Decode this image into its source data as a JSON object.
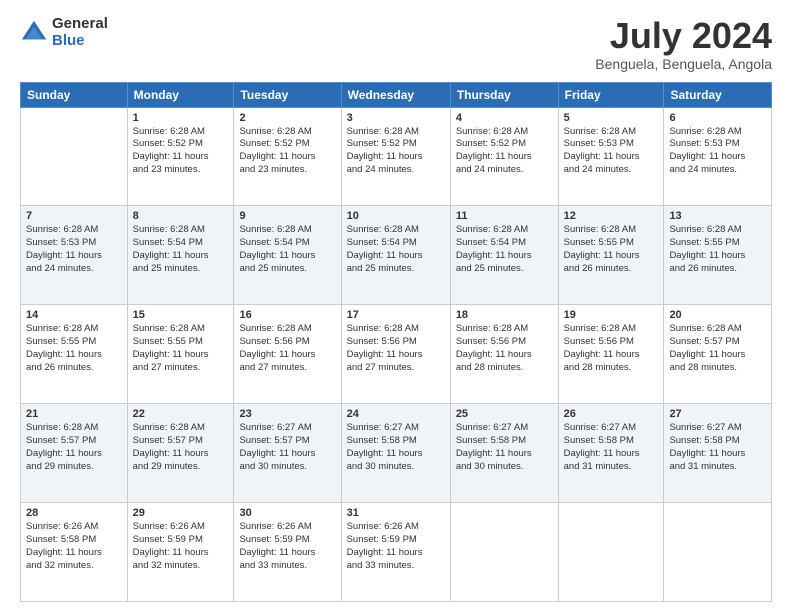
{
  "logo": {
    "general": "General",
    "blue": "Blue"
  },
  "title": "July 2024",
  "location": "Benguela, Benguela, Angola",
  "header_days": [
    "Sunday",
    "Monday",
    "Tuesday",
    "Wednesday",
    "Thursday",
    "Friday",
    "Saturday"
  ],
  "weeks": [
    [
      {
        "day": "",
        "info": ""
      },
      {
        "day": "1",
        "info": "Sunrise: 6:28 AM\nSunset: 5:52 PM\nDaylight: 11 hours\nand 23 minutes."
      },
      {
        "day": "2",
        "info": "Sunrise: 6:28 AM\nSunset: 5:52 PM\nDaylight: 11 hours\nand 23 minutes."
      },
      {
        "day": "3",
        "info": "Sunrise: 6:28 AM\nSunset: 5:52 PM\nDaylight: 11 hours\nand 24 minutes."
      },
      {
        "day": "4",
        "info": "Sunrise: 6:28 AM\nSunset: 5:52 PM\nDaylight: 11 hours\nand 24 minutes."
      },
      {
        "day": "5",
        "info": "Sunrise: 6:28 AM\nSunset: 5:53 PM\nDaylight: 11 hours\nand 24 minutes."
      },
      {
        "day": "6",
        "info": "Sunrise: 6:28 AM\nSunset: 5:53 PM\nDaylight: 11 hours\nand 24 minutes."
      }
    ],
    [
      {
        "day": "7",
        "info": "Sunrise: 6:28 AM\nSunset: 5:53 PM\nDaylight: 11 hours\nand 24 minutes."
      },
      {
        "day": "8",
        "info": "Sunrise: 6:28 AM\nSunset: 5:54 PM\nDaylight: 11 hours\nand 25 minutes."
      },
      {
        "day": "9",
        "info": "Sunrise: 6:28 AM\nSunset: 5:54 PM\nDaylight: 11 hours\nand 25 minutes."
      },
      {
        "day": "10",
        "info": "Sunrise: 6:28 AM\nSunset: 5:54 PM\nDaylight: 11 hours\nand 25 minutes."
      },
      {
        "day": "11",
        "info": "Sunrise: 6:28 AM\nSunset: 5:54 PM\nDaylight: 11 hours\nand 25 minutes."
      },
      {
        "day": "12",
        "info": "Sunrise: 6:28 AM\nSunset: 5:55 PM\nDaylight: 11 hours\nand 26 minutes."
      },
      {
        "day": "13",
        "info": "Sunrise: 6:28 AM\nSunset: 5:55 PM\nDaylight: 11 hours\nand 26 minutes."
      }
    ],
    [
      {
        "day": "14",
        "info": "Sunrise: 6:28 AM\nSunset: 5:55 PM\nDaylight: 11 hours\nand 26 minutes."
      },
      {
        "day": "15",
        "info": "Sunrise: 6:28 AM\nSunset: 5:55 PM\nDaylight: 11 hours\nand 27 minutes."
      },
      {
        "day": "16",
        "info": "Sunrise: 6:28 AM\nSunset: 5:56 PM\nDaylight: 11 hours\nand 27 minutes."
      },
      {
        "day": "17",
        "info": "Sunrise: 6:28 AM\nSunset: 5:56 PM\nDaylight: 11 hours\nand 27 minutes."
      },
      {
        "day": "18",
        "info": "Sunrise: 6:28 AM\nSunset: 5:56 PM\nDaylight: 11 hours\nand 28 minutes."
      },
      {
        "day": "19",
        "info": "Sunrise: 6:28 AM\nSunset: 5:56 PM\nDaylight: 11 hours\nand 28 minutes."
      },
      {
        "day": "20",
        "info": "Sunrise: 6:28 AM\nSunset: 5:57 PM\nDaylight: 11 hours\nand 28 minutes."
      }
    ],
    [
      {
        "day": "21",
        "info": "Sunrise: 6:28 AM\nSunset: 5:57 PM\nDaylight: 11 hours\nand 29 minutes."
      },
      {
        "day": "22",
        "info": "Sunrise: 6:28 AM\nSunset: 5:57 PM\nDaylight: 11 hours\nand 29 minutes."
      },
      {
        "day": "23",
        "info": "Sunrise: 6:27 AM\nSunset: 5:57 PM\nDaylight: 11 hours\nand 30 minutes."
      },
      {
        "day": "24",
        "info": "Sunrise: 6:27 AM\nSunset: 5:58 PM\nDaylight: 11 hours\nand 30 minutes."
      },
      {
        "day": "25",
        "info": "Sunrise: 6:27 AM\nSunset: 5:58 PM\nDaylight: 11 hours\nand 30 minutes."
      },
      {
        "day": "26",
        "info": "Sunrise: 6:27 AM\nSunset: 5:58 PM\nDaylight: 11 hours\nand 31 minutes."
      },
      {
        "day": "27",
        "info": "Sunrise: 6:27 AM\nSunset: 5:58 PM\nDaylight: 11 hours\nand 31 minutes."
      }
    ],
    [
      {
        "day": "28",
        "info": "Sunrise: 6:26 AM\nSunset: 5:58 PM\nDaylight: 11 hours\nand 32 minutes."
      },
      {
        "day": "29",
        "info": "Sunrise: 6:26 AM\nSunset: 5:59 PM\nDaylight: 11 hours\nand 32 minutes."
      },
      {
        "day": "30",
        "info": "Sunrise: 6:26 AM\nSunset: 5:59 PM\nDaylight: 11 hours\nand 33 minutes."
      },
      {
        "day": "31",
        "info": "Sunrise: 6:26 AM\nSunset: 5:59 PM\nDaylight: 11 hours\nand 33 minutes."
      },
      {
        "day": "",
        "info": ""
      },
      {
        "day": "",
        "info": ""
      },
      {
        "day": "",
        "info": ""
      }
    ]
  ]
}
